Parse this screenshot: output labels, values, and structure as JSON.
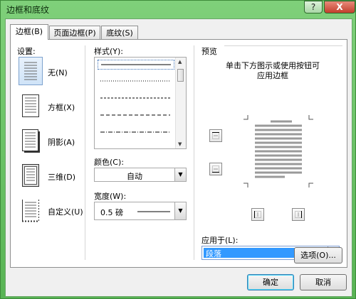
{
  "window": {
    "title": "边框和底纹",
    "help_label": "?",
    "close_label": "X"
  },
  "tabs": [
    {
      "label": "边框(B)",
      "active": true
    },
    {
      "label": "页面边框(P)",
      "active": false
    },
    {
      "label": "底纹(S)",
      "active": false
    }
  ],
  "settings": {
    "heading": "设置:",
    "items": [
      {
        "label": "无(N)",
        "icon": "border-none-icon",
        "selected": true
      },
      {
        "label": "方框(X)",
        "icon": "border-box-icon",
        "selected": false
      },
      {
        "label": "阴影(A)",
        "icon": "border-shadow-icon",
        "selected": false
      },
      {
        "label": "三维(D)",
        "icon": "border-3d-icon",
        "selected": false
      },
      {
        "label": "自定义(U)",
        "icon": "border-custom-icon",
        "selected": false
      }
    ]
  },
  "style": {
    "heading": "样式(Y):",
    "options": [
      "solid",
      "dotted",
      "dashed-small",
      "dashed",
      "dash-dot"
    ]
  },
  "color": {
    "heading": "颜色(C):",
    "value": "自动"
  },
  "width": {
    "heading": "宽度(W):",
    "value": "0.5 磅"
  },
  "preview": {
    "heading": "预览",
    "instruction_line1": "单击下方图示或使用按钮可",
    "instruction_line2": "应用边框"
  },
  "apply_to": {
    "heading": "应用于(L):",
    "value": "段落"
  },
  "buttons": {
    "options": "选项(O)...",
    "ok": "确定",
    "cancel": "取消"
  },
  "colors": {
    "title_bar": "#7fd07a",
    "selection": "#3399ff",
    "default_button_border": "#3c7fb1"
  }
}
